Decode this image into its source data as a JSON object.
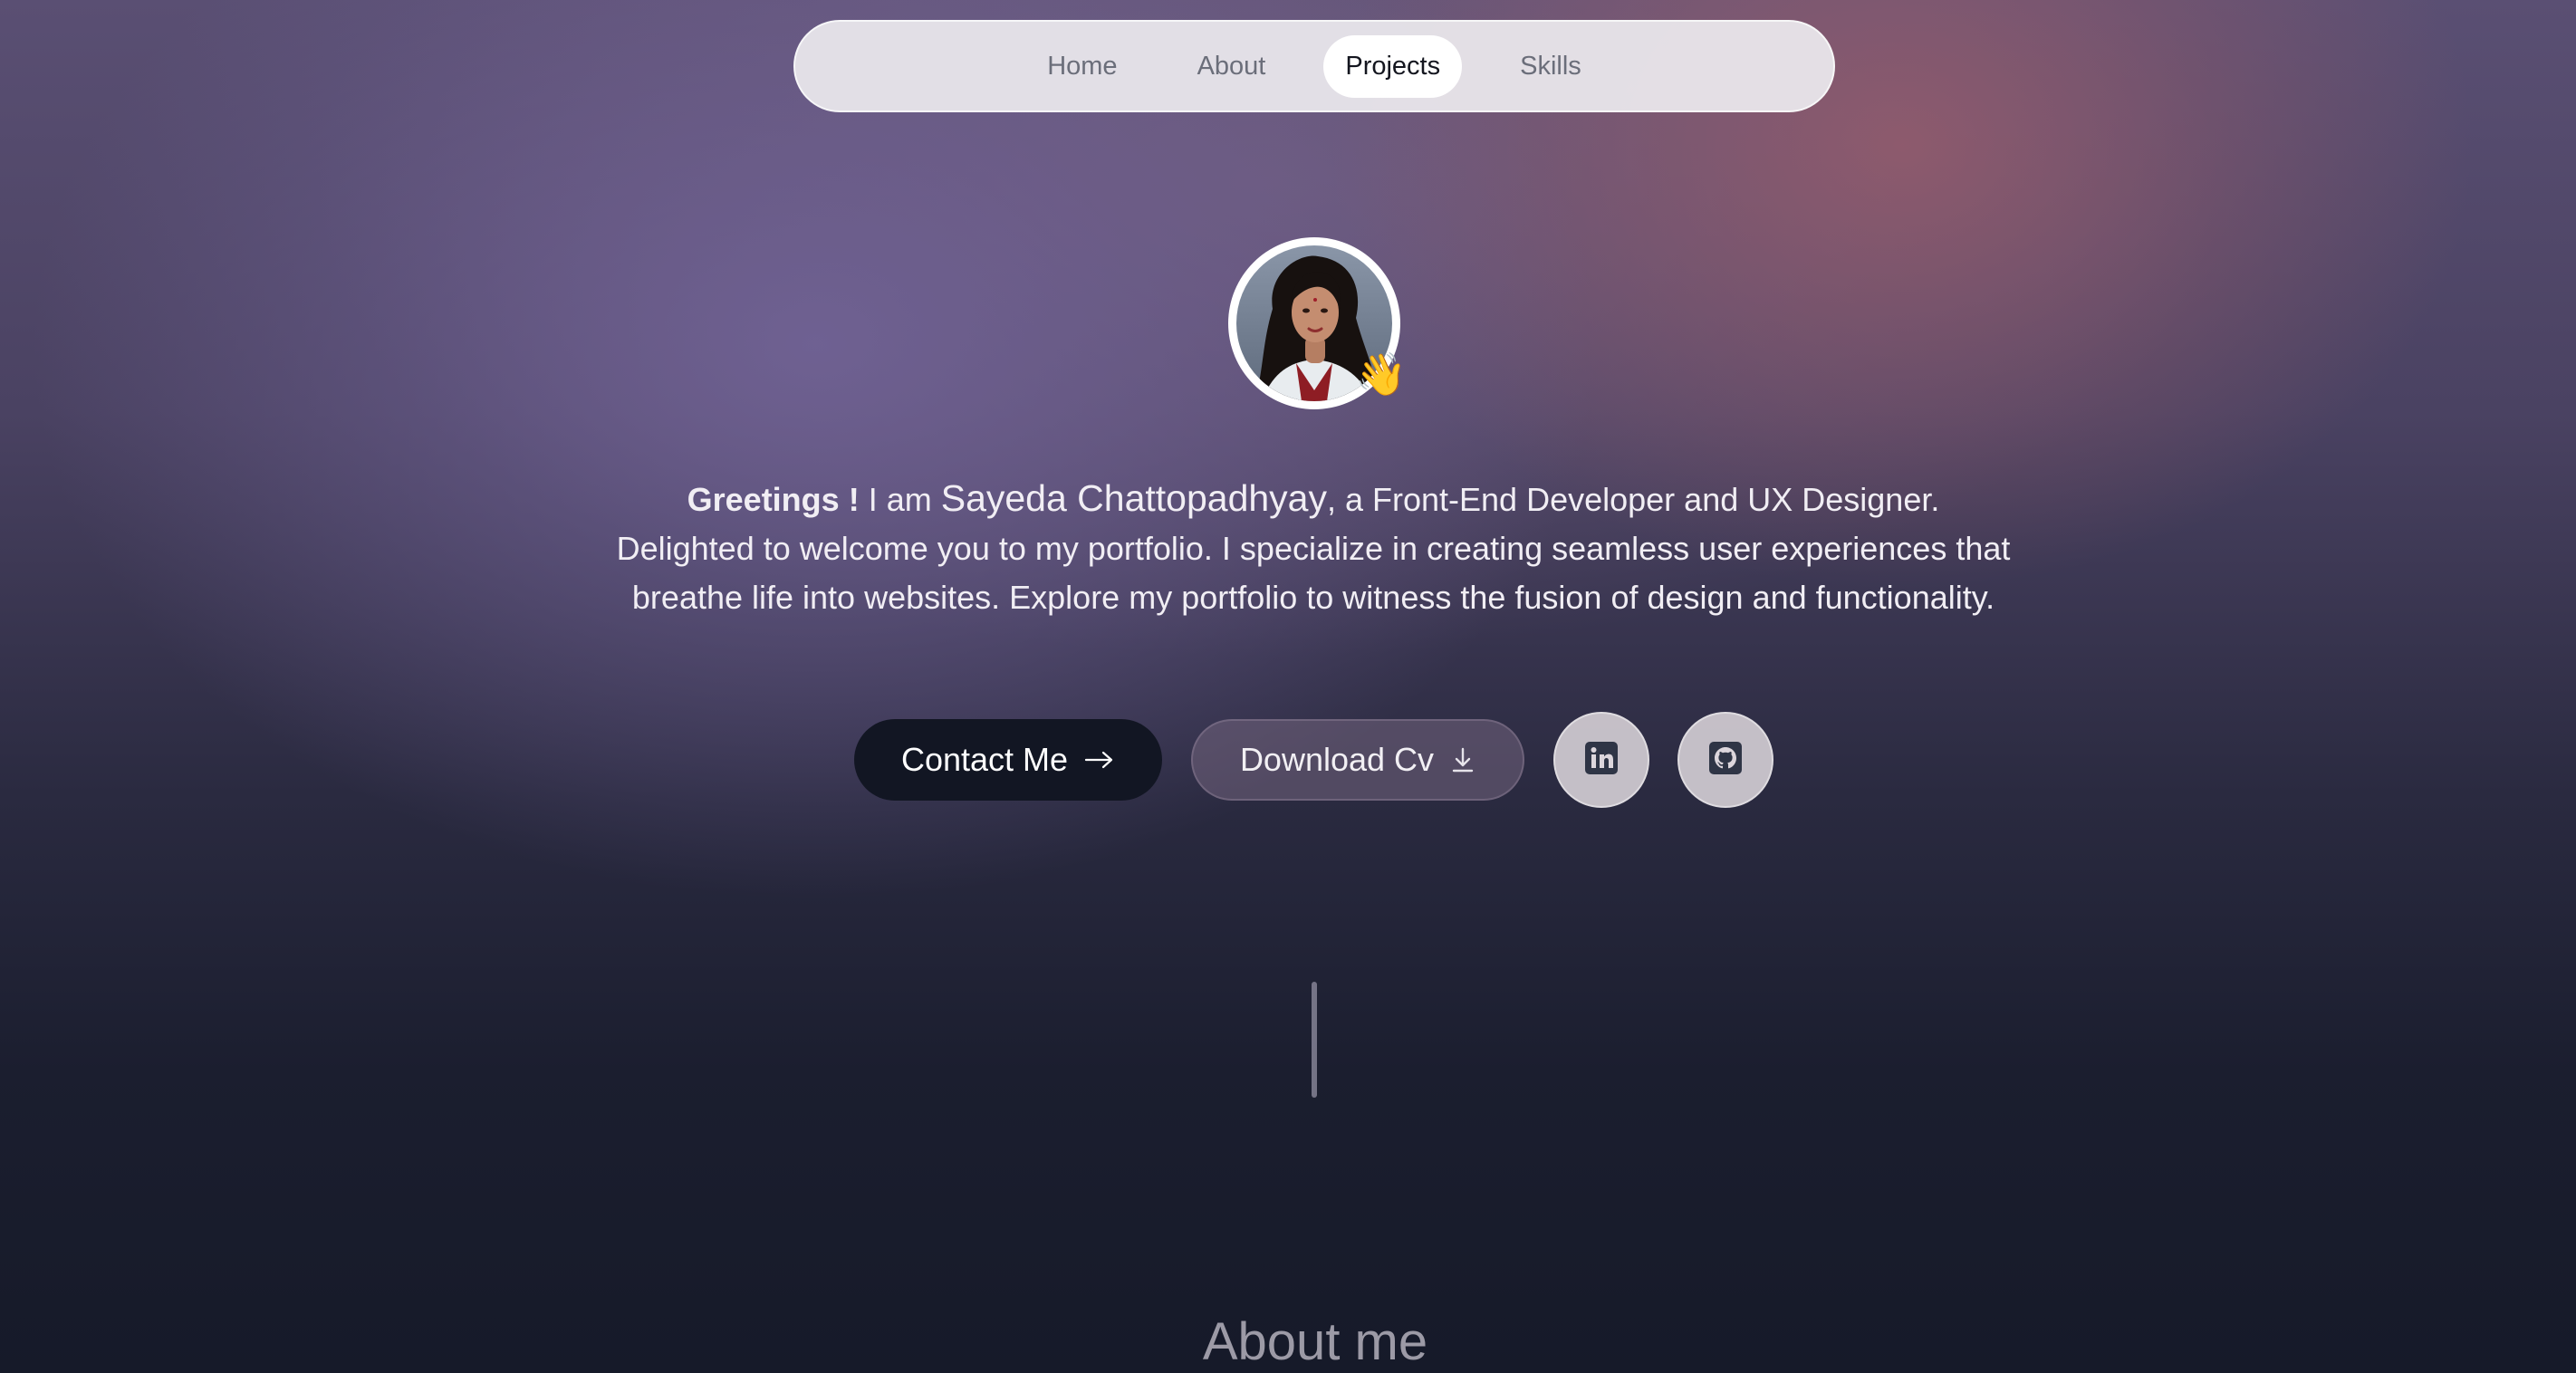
{
  "nav": {
    "items": [
      {
        "label": "Home",
        "active": false
      },
      {
        "label": "About",
        "active": false
      },
      {
        "label": "Projects",
        "active": true
      },
      {
        "label": "Skills",
        "active": false
      }
    ]
  },
  "hero": {
    "greeting": "Greetings !",
    "i_am": " I am ",
    "name": "Sayeda Chattopadhyay",
    "intro_rest": ", a Front-End Developer and UX Designer. Delighted to welcome you to my portfolio. I specialize in creating seamless user experiences that breathe life into websites. Explore my portfolio to witness the fusion of design and functionality.",
    "wave_emoji": "👋"
  },
  "actions": {
    "contact_label": "Contact Me",
    "contact_icon": "arrow-right-icon",
    "cv_label": "Download Cv",
    "cv_icon": "download-icon",
    "social": [
      {
        "icon": "linkedin-icon"
      },
      {
        "icon": "github-icon"
      }
    ]
  },
  "about": {
    "title": "About me"
  },
  "colors": {
    "nav_bg": "#ECE9EE",
    "primary_button": "#121623",
    "page_dark": "#161A29"
  }
}
